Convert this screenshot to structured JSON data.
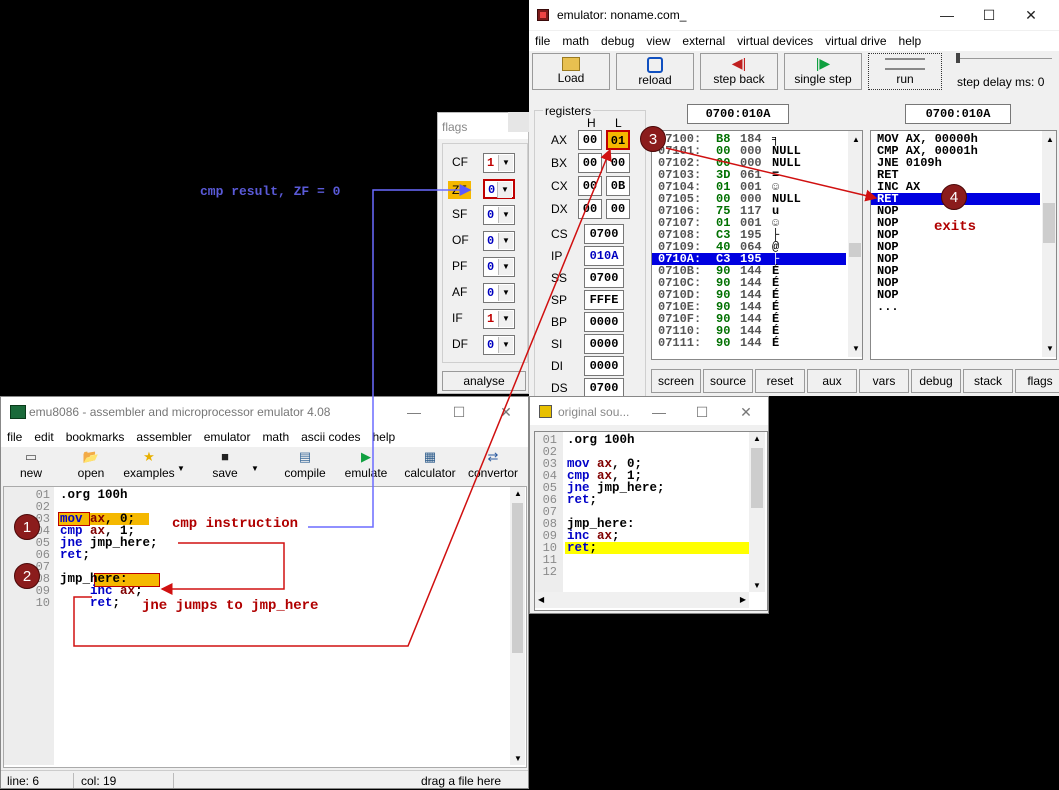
{
  "emulator": {
    "title": "emulator: noname.com_",
    "menu": [
      "file",
      "math",
      "debug",
      "view",
      "external",
      "virtual devices",
      "virtual drive",
      "help"
    ],
    "toolbar": {
      "load": "Load",
      "reload": "reload",
      "step_back": "step back",
      "single_step": "single step",
      "run": "run",
      "step_delay": "step delay ms: 0"
    },
    "registers_label": "registers",
    "h_label": "H",
    "l_label": "L",
    "addr_left": "0700:010A",
    "addr_right": "0700:010A",
    "regs": [
      {
        "name": "AX",
        "h": "00",
        "l": "01"
      },
      {
        "name": "BX",
        "h": "00",
        "l": "00"
      },
      {
        "name": "CX",
        "h": "00",
        "l": "0B"
      },
      {
        "name": "DX",
        "h": "00",
        "l": "00"
      }
    ],
    "seg": [
      {
        "name": "CS",
        "val": "0700"
      },
      {
        "name": "IP",
        "val": "010A"
      },
      {
        "name": "SS",
        "val": "0700"
      },
      {
        "name": "SP",
        "val": "FFFE"
      },
      {
        "name": "BP",
        "val": "0000"
      },
      {
        "name": "SI",
        "val": "0000"
      },
      {
        "name": "DI",
        "val": "0000"
      },
      {
        "name": "DS",
        "val": "0700"
      }
    ],
    "memory": [
      {
        "addr": "07100:",
        "hex": "B8",
        "dec": "184",
        "ch": "╕"
      },
      {
        "addr": "07101:",
        "hex": "00",
        "dec": "000",
        "ch": "NULL"
      },
      {
        "addr": "07102:",
        "hex": "00",
        "dec": "000",
        "ch": "NULL"
      },
      {
        "addr": "07103:",
        "hex": "3D",
        "dec": "061",
        "ch": "="
      },
      {
        "addr": "07104:",
        "hex": "01",
        "dec": "001",
        "ch": "☺"
      },
      {
        "addr": "07105:",
        "hex": "00",
        "dec": "000",
        "ch": "NULL"
      },
      {
        "addr": "07106:",
        "hex": "75",
        "dec": "117",
        "ch": "u"
      },
      {
        "addr": "07107:",
        "hex": "01",
        "dec": "001",
        "ch": "☺"
      },
      {
        "addr": "07108:",
        "hex": "C3",
        "dec": "195",
        "ch": "├"
      },
      {
        "addr": "07109:",
        "hex": "40",
        "dec": "064",
        "ch": "@"
      },
      {
        "addr": "0710A:",
        "hex": "C3",
        "dec": "195",
        "ch": "├"
      },
      {
        "addr": "0710B:",
        "hex": "90",
        "dec": "144",
        "ch": "É"
      },
      {
        "addr": "0710C:",
        "hex": "90",
        "dec": "144",
        "ch": "É"
      },
      {
        "addr": "0710D:",
        "hex": "90",
        "dec": "144",
        "ch": "É"
      },
      {
        "addr": "0710E:",
        "hex": "90",
        "dec": "144",
        "ch": "É"
      },
      {
        "addr": "0710F:",
        "hex": "90",
        "dec": "144",
        "ch": "É"
      },
      {
        "addr": "07110:",
        "hex": "90",
        "dec": "144",
        "ch": "É"
      },
      {
        "addr": "07111:",
        "hex": "90",
        "dec": "144",
        "ch": "É"
      }
    ],
    "disasm": [
      "MOV AX, 00000h",
      "CMP AX, 00001h",
      "JNE 0109h",
      "RET",
      "INC AX",
      "RET",
      "NOP",
      "NOP",
      "NOP",
      "NOP",
      "NOP",
      "NOP",
      "NOP",
      "NOP",
      "..."
    ],
    "bottom_buttons": [
      "screen",
      "source",
      "reset",
      "aux",
      "vars",
      "debug",
      "stack",
      "flags"
    ]
  },
  "flags": {
    "title": "flags",
    "items": [
      {
        "name": "CF",
        "val": "1"
      },
      {
        "name": "ZF",
        "val": "0"
      },
      {
        "name": "SF",
        "val": "0"
      },
      {
        "name": "OF",
        "val": "0"
      },
      {
        "name": "PF",
        "val": "0"
      },
      {
        "name": "AF",
        "val": "0"
      },
      {
        "name": "IF",
        "val": "1"
      },
      {
        "name": "DF",
        "val": "0"
      }
    ],
    "analyse": "analyse"
  },
  "editor": {
    "title": "emu8086 - assembler and microprocessor emulator 4.08",
    "menu": [
      "file",
      "edit",
      "bookmarks",
      "assembler",
      "emulator",
      "math",
      "ascii codes",
      "help"
    ],
    "toolbar": [
      "new",
      "open",
      "examples",
      "save",
      "compile",
      "emulate",
      "calculator",
      "convertor"
    ],
    "line_numbers": [
      "01",
      "02",
      "03",
      "04",
      "05",
      "06",
      "07",
      "08",
      "09",
      "10"
    ],
    "status": {
      "line": "line: 6",
      "col": "col: 19",
      "hint": "drag a file here"
    }
  },
  "source": {
    "title": "original sou...",
    "line_numbers": [
      "01",
      "02",
      "03",
      "04",
      "05",
      "06",
      "07",
      "08",
      "09",
      "10",
      "11",
      "12"
    ]
  },
  "annotations": {
    "cmp_result": "cmp result, ZF = 0",
    "cmp_instruction": "cmp instruction",
    "jne_jumps": "jne jumps to jmp_here",
    "exits": "exits",
    "n1": "1",
    "n2": "2",
    "n3": "3",
    "n4": "4"
  }
}
